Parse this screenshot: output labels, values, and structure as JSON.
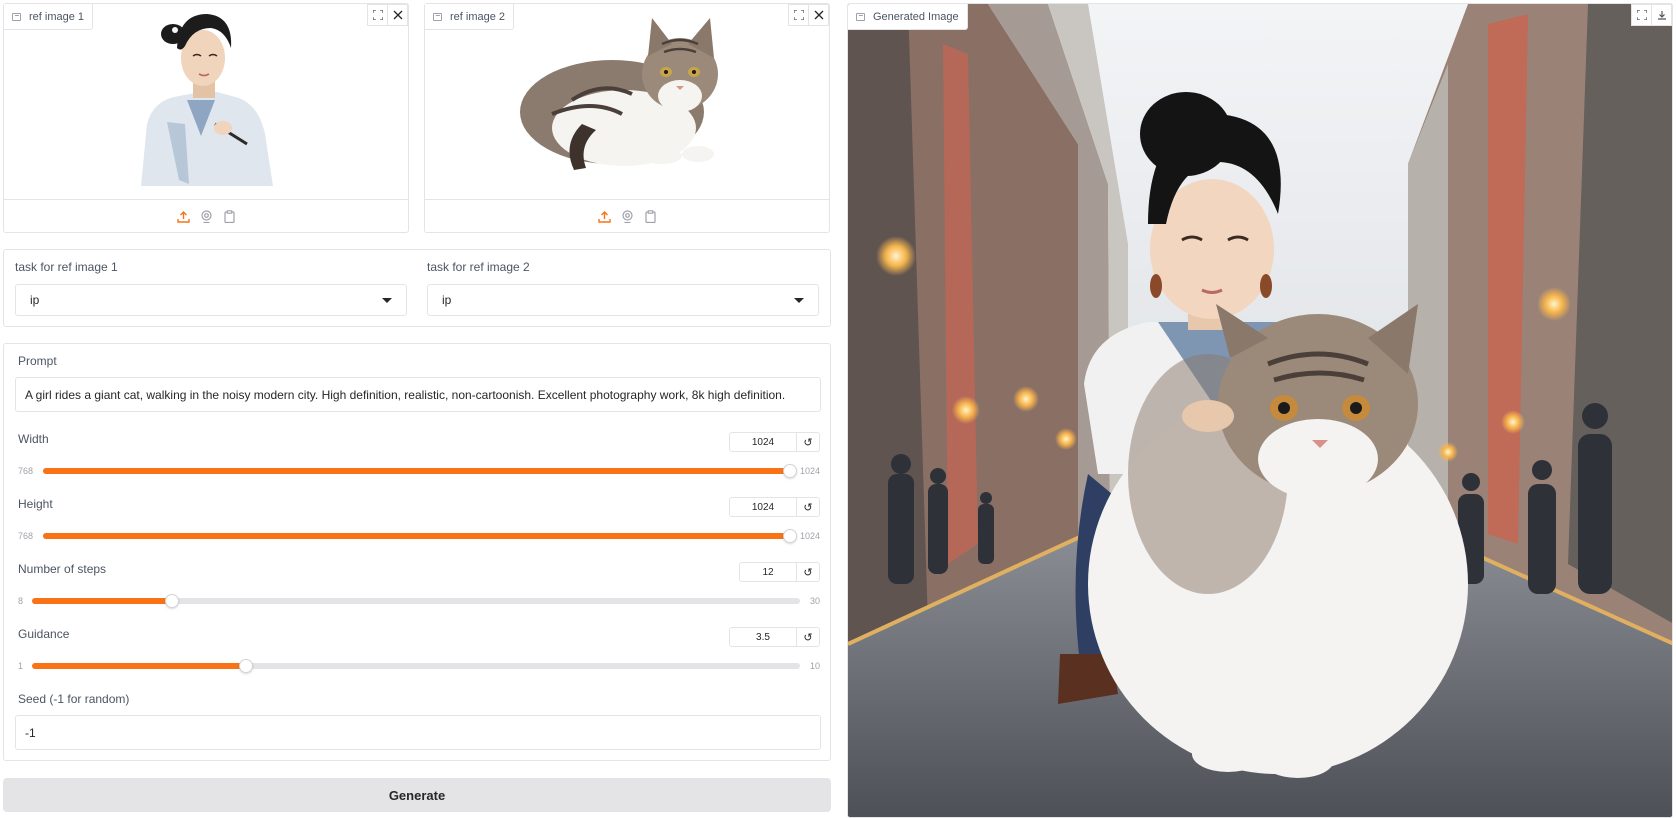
{
  "ref_image_1": {
    "label": "ref image 1",
    "subject": "illustrated girl in white blouse holding a brush"
  },
  "ref_image_2": {
    "label": "ref image 2",
    "subject": "tabby and white cat lying down"
  },
  "task_1": {
    "label": "task for ref image 1",
    "value": "ip"
  },
  "task_2": {
    "label": "task for ref image 2",
    "value": "ip"
  },
  "prompt": {
    "label": "Prompt",
    "value": "A girl rides a giant cat, walking in the noisy modern city. High definition, realistic, non-cartoonish. Excellent photography work, 8k high definition."
  },
  "width": {
    "label": "Width",
    "value": "1024",
    "min": "768",
    "max": "1024",
    "fraction": 1.0
  },
  "height": {
    "label": "Height",
    "value": "1024",
    "min": "768",
    "max": "1024",
    "fraction": 1.0
  },
  "steps": {
    "label": "Number of steps",
    "value": "12",
    "min": "8",
    "max": "30",
    "fraction": 0.182
  },
  "guidance": {
    "label": "Guidance",
    "value": "3.5",
    "min": "1",
    "max": "10",
    "fraction": 0.278
  },
  "seed": {
    "label": "Seed (-1 for random)",
    "value": "-1"
  },
  "generate": {
    "label": "Generate"
  },
  "generated": {
    "label": "Generated Image",
    "subject": "girl riding a giant cat on a city street"
  },
  "colors": {
    "accent": "#f97316",
    "border": "#e4e4e7",
    "button_bg": "#e4e4e7"
  },
  "icons": {
    "upload": "upload-icon",
    "webcam": "webcam-icon",
    "clipboard": "clipboard-icon",
    "fullscreen": "fullscreen-icon",
    "close": "close-icon",
    "download": "download-icon",
    "reset": "reset-icon",
    "image": "image-icon"
  }
}
